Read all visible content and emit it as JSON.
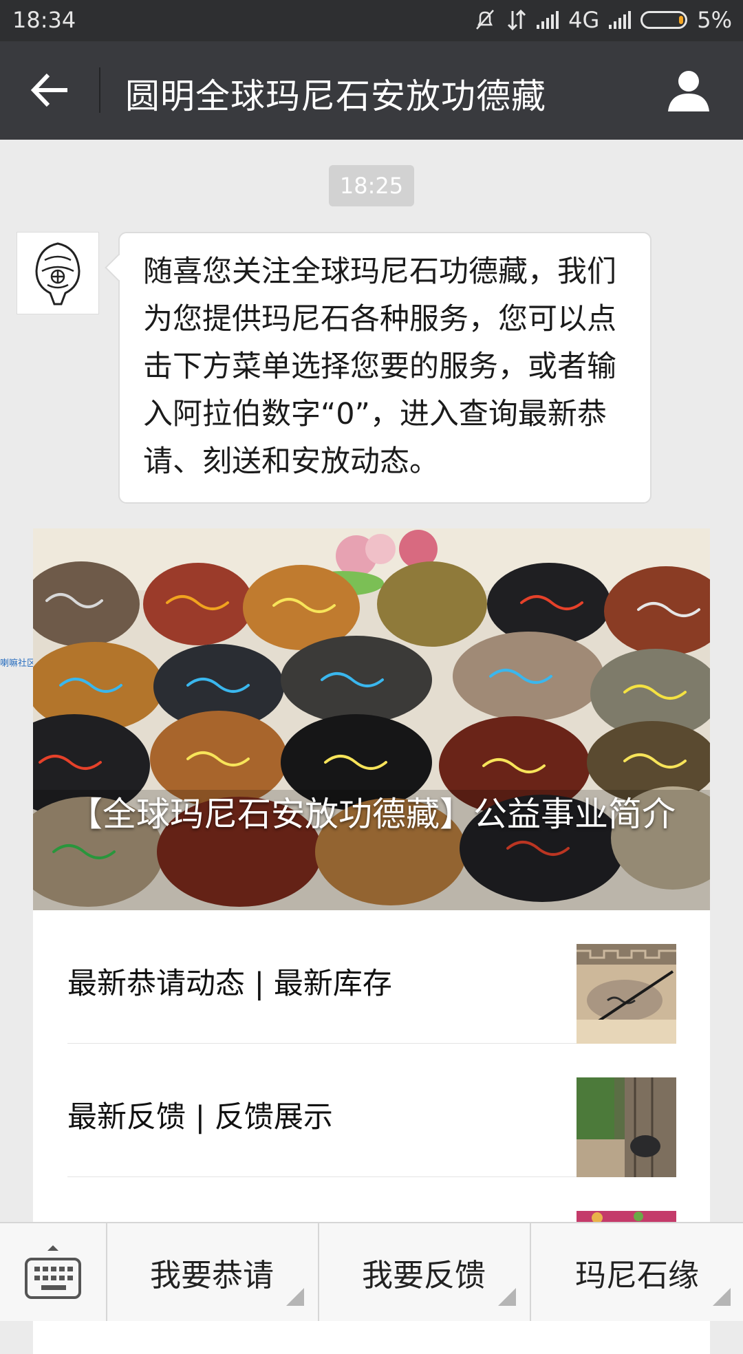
{
  "status_bar": {
    "time": "18:34",
    "network": "4G",
    "battery": "5%",
    "icons": [
      "mute-icon",
      "data-transfer-icon",
      "signal-icon",
      "battery-icon"
    ]
  },
  "nav": {
    "title": "圆明全球玛尼石安放功德藏",
    "back_icon": "back-arrow-icon",
    "profile_icon": "profile-icon"
  },
  "chat": {
    "timestamp": "18:25",
    "message": "随喜您关注全球玛尼石功德藏，我们为您提供玛尼石各种服务，您可以点击下方菜单选择您要的服务，或者输入阿拉伯数字“0”，进入查询最新恭请、刻送和安放动态。"
  },
  "article": {
    "hero_title": "【全球玛尼石安放功德藏】公益事业简介",
    "items": [
      {
        "label": "最新恭请动态 | 最新库存"
      },
      {
        "label": "最新反馈 | 反馈展示"
      }
    ]
  },
  "side_tag": "喇嘛社区",
  "menu": {
    "keyboard_icon": "keyboard-icon",
    "buttons": [
      {
        "label": "我要恭请"
      },
      {
        "label": "我要反馈"
      },
      {
        "label": "玛尼石缘"
      }
    ]
  }
}
